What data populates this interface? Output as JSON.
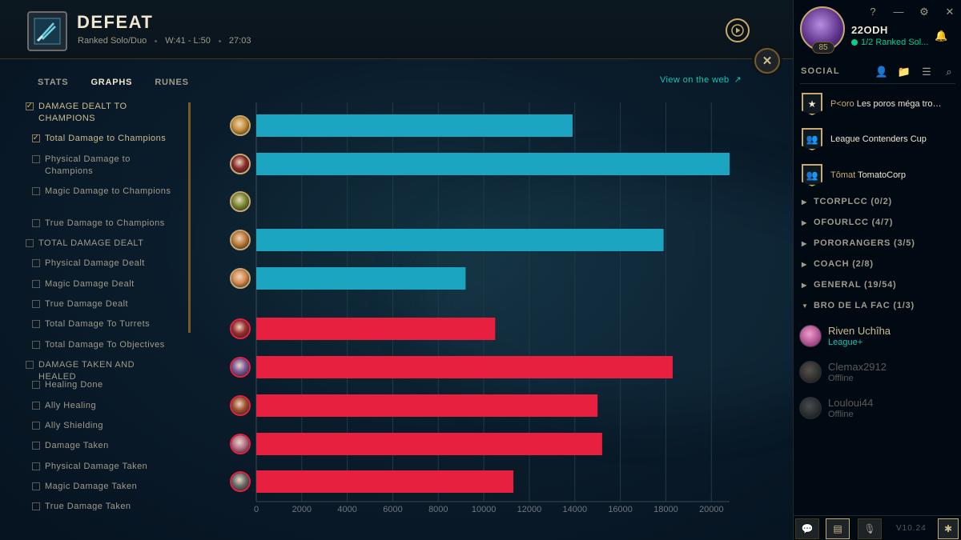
{
  "header": {
    "result": "DEFEAT",
    "queue": "Ranked Solo/Duo",
    "record": "W:41 - L:50",
    "duration": "27:03"
  },
  "tabs": [
    {
      "label": "STATS",
      "active": false
    },
    {
      "label": "GRAPHS",
      "active": true
    },
    {
      "label": "RUNES",
      "active": false
    }
  ],
  "web_link": "View on the web",
  "stat_options": [
    {
      "label": "DAMAGE DEALT TO CHAMPIONS",
      "group": true,
      "checked": true
    },
    {
      "label": "Total Damage to Champions",
      "group": false,
      "checked": true
    },
    {
      "label": "Physical Damage to Champions",
      "group": false,
      "checked": false
    },
    {
      "label": "Magic Damage to Champions",
      "group": false,
      "checked": false
    },
    {
      "label": "True Damage to Champions",
      "group": false,
      "checked": false
    },
    {
      "label": "TOTAL DAMAGE DEALT",
      "group": true,
      "checked": false
    },
    {
      "label": "Physical Damage Dealt",
      "group": false,
      "checked": false
    },
    {
      "label": "Magic Damage Dealt",
      "group": false,
      "checked": false
    },
    {
      "label": "True Damage Dealt",
      "group": false,
      "checked": false
    },
    {
      "label": "Total Damage To Turrets",
      "group": false,
      "checked": false
    },
    {
      "label": "Total Damage To Objectives",
      "group": false,
      "checked": false
    },
    {
      "label": "DAMAGE TAKEN AND HEALED",
      "group": true,
      "checked": false
    },
    {
      "label": "Healing Done",
      "group": false,
      "checked": false
    },
    {
      "label": "Ally Healing",
      "group": false,
      "checked": false
    },
    {
      "label": "Ally Shielding",
      "group": false,
      "checked": false
    },
    {
      "label": "Damage Taken",
      "group": false,
      "checked": false
    },
    {
      "label": "Physical Damage Taken",
      "group": false,
      "checked": false
    },
    {
      "label": "Magic Damage Taken",
      "group": false,
      "checked": false
    },
    {
      "label": "True Damage Taken",
      "group": false,
      "checked": false
    }
  ],
  "chart_data": {
    "type": "bar",
    "orientation": "horizontal",
    "xlim": [
      0,
      20800
    ],
    "x_ticks": [
      "0",
      "2000",
      "4000",
      "6000",
      "8000",
      "10000",
      "12000",
      "14000",
      "16000",
      "18000",
      "20000"
    ],
    "grid": true,
    "colors": {
      "blue_team": "#1ca5c0",
      "red_team": "#e8203f"
    },
    "series": [
      {
        "team": "blue",
        "values": [
          13900,
          20800,
          0,
          17900,
          9200
        ]
      },
      {
        "team": "red",
        "values": [
          10500,
          18300,
          15000,
          15200,
          11300
        ]
      }
    ],
    "champion_icon_colors": {
      "blue": [
        "#c98f3a",
        "#8a2a2a",
        "#7a8a30",
        "#c07a3a",
        "#d98a50"
      ],
      "red": [
        "#9a3030",
        "#7a5a9a",
        "#a05030",
        "#b8708a",
        "#6a6a6a"
      ]
    }
  },
  "sidebar": {
    "profile": {
      "name": "22ODH",
      "status": "1/2 Ranked Sol...",
      "level": "85"
    },
    "top_icons": [
      "help-icon",
      "minimize-icon",
      "settings-icon",
      "close-icon"
    ],
    "social_title": "SOCIAL",
    "social_icons": [
      "add-friend-icon",
      "add-folder-icon",
      "list-icon",
      "search-icon"
    ],
    "clubs": [
      {
        "tag": "P<oro",
        "name": "Les poros méga trop f...",
        "icon": "★"
      },
      {
        "tag": "",
        "name": "League Contenders Cup",
        "icon": "👥"
      },
      {
        "tag": "Tômat",
        "name": "TomatoCorp",
        "icon": "👥"
      }
    ],
    "groups": [
      "TCORPLCC (0/2)",
      "OFOURLCC (4/7)",
      "PORORANGERS (3/5)",
      "COACH (2/8)",
      "GENERAL (19/54)",
      "BRO DE LA FAC (1/3)"
    ],
    "friends": [
      {
        "name": "Riven Uchîha",
        "state": "League+",
        "online": true
      },
      {
        "name": "Clemax2912",
        "state": "Offline",
        "online": false
      },
      {
        "name": "Louloui44",
        "state": "Offline",
        "online": false
      }
    ],
    "version": "V10.24"
  }
}
